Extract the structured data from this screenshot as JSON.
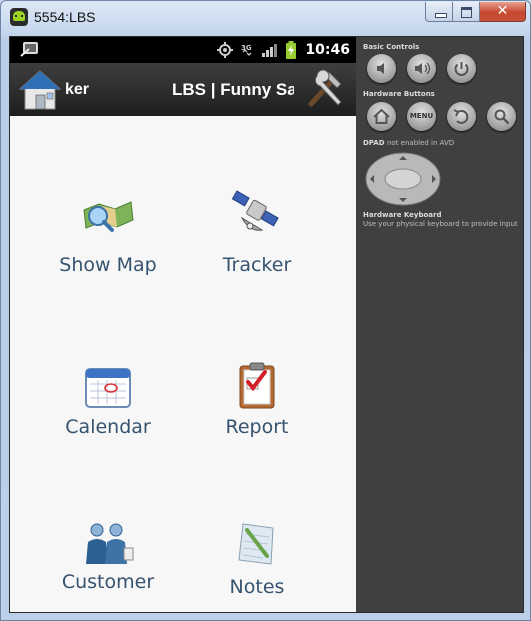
{
  "window": {
    "title": "5554:LBS",
    "minimize_icon": "minimize-icon",
    "maximize_icon": "maximize-icon",
    "close_glyph": "✕"
  },
  "statusbar": {
    "time": "10:46",
    "icons": [
      "usb-debug-icon",
      "gps-icon",
      "3g-icon",
      "signal-icon",
      "battery-charging-icon"
    ]
  },
  "actionbar": {
    "title_left": "ker",
    "title": "LBS | Funny Sa",
    "home_icon": "house-icon",
    "tools_icon": "tools-icon"
  },
  "menu": {
    "show_map": "Show Map",
    "tracker": "Tracker",
    "calendar": "Calendar",
    "report": "Report",
    "customer": "Customer",
    "notes": "Notes"
  },
  "controls": {
    "basic_title": "Basic Controls",
    "hardware_title": "Hardware Buttons",
    "menu_label": "MENU",
    "dpad_title": "DPAD",
    "dpad_note": "not enabled in AVD",
    "keyboard_title": "Hardware Keyboard",
    "keyboard_note": "Use your physical keyboard to provide input"
  },
  "colors": {
    "label_text": "#36536f",
    "screen_bg": "#f7f7f7",
    "panel_bg": "#404040"
  }
}
